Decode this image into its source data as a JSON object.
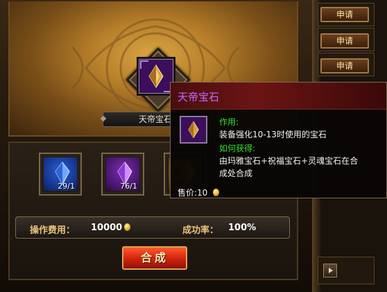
{
  "craft": {
    "item_name": "天帝宝石",
    "materials": [
      {
        "count": "29/1",
        "color": "#2a5fd2"
      },
      {
        "count": "76/1",
        "color": "#7c2db0"
      },
      {
        "count": "",
        "color": "#b07a20"
      }
    ],
    "cost_label": "操作费用：",
    "cost_value": "10000",
    "rate_label": "成功率：",
    "rate_value": "100%",
    "craft_button": "合成"
  },
  "right_panel": {
    "apply_buttons": [
      "申请",
      "申请",
      "申请"
    ]
  },
  "tooltip": {
    "title": "天帝宝石",
    "usage_label": "作用:",
    "usage_text": "装备强化10-13时使用的宝石",
    "obtain_label": "如何获得:",
    "obtain_text_1": "由玛雅宝石+祝福宝石+灵魂宝石在合",
    "obtain_text_2": "成处合成",
    "price_label": "售价:",
    "price_value": "10"
  },
  "colors": {
    "title_purple": "#c26bff",
    "text_green": "#30e02a",
    "gem_purple": "#7c2db0",
    "gem_blue": "#2a5fd2",
    "button_red": "#d6250e",
    "label_gold": "#e9c27a"
  },
  "icons": [
    "gem-icon",
    "coin-icon",
    "play-arrow-icon"
  ]
}
